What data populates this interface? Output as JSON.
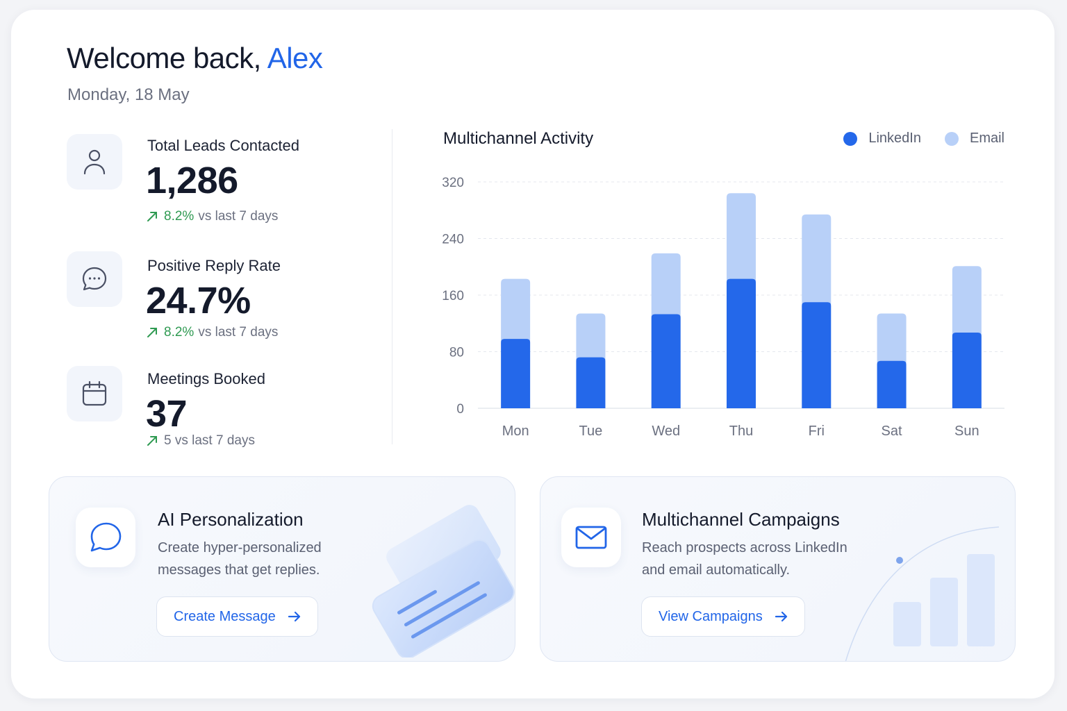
{
  "header": {
    "greeting": "Welcome back,",
    "user_name": "Alex",
    "date": "Monday, 18 May"
  },
  "stats": [
    {
      "label": "Total Leads Contacted",
      "value": "1,286",
      "trend_value": "8.2%",
      "trend_text": "vs last 7 days",
      "icon": "user-icon"
    },
    {
      "label": "Positive Reply Rate",
      "value": "24.7%",
      "trend_value": "8.2%",
      "trend_text": "vs last 7 days",
      "icon": "chat-bubble-icon"
    },
    {
      "label": "Meetings Booked",
      "value": "37",
      "trend_value": "",
      "trend_text": "5 vs last 7 days",
      "icon": "calendar-icon"
    }
  ],
  "chart": {
    "title": "Multichannel Activity",
    "legend": [
      {
        "name": "LinkedIn",
        "color": "#2468ea"
      },
      {
        "name": "Email",
        "color": "#b8d0f8"
      }
    ]
  },
  "chart_data": {
    "type": "bar",
    "stacked": true,
    "title": "Multichannel Activity",
    "categories": [
      "Mon",
      "Tue",
      "Wed",
      "Thu",
      "Fri",
      "Sat",
      "Sun"
    ],
    "series": [
      {
        "name": "LinkedIn",
        "values": [
          98,
          72,
          133,
          183,
          150,
          67,
          107
        ],
        "color": "#2468ea"
      },
      {
        "name": "Email",
        "values": [
          85,
          62,
          86,
          121,
          124,
          67,
          94
        ],
        "color": "#b8d0f8"
      }
    ],
    "yticks": [
      0,
      80,
      160,
      240,
      320
    ],
    "ylim": [
      0,
      320
    ],
    "grid": true,
    "legend_position": "top-right"
  },
  "features": [
    {
      "title": "AI Personalization",
      "description": "Create hyper-personalized messages that get replies.",
      "button_label": "Create Message",
      "icon": "chat-bubble-icon"
    },
    {
      "title": "Multichannel Campaigns",
      "description": "Reach prospects across LinkedIn and email automatically.",
      "button_label": "View Campaigns",
      "icon": "envelope-icon"
    }
  ],
  "colors": {
    "accent": "#2165e8",
    "positive": "#2f9a52",
    "linkedin": "#2468ea",
    "email": "#b8d0f8"
  }
}
